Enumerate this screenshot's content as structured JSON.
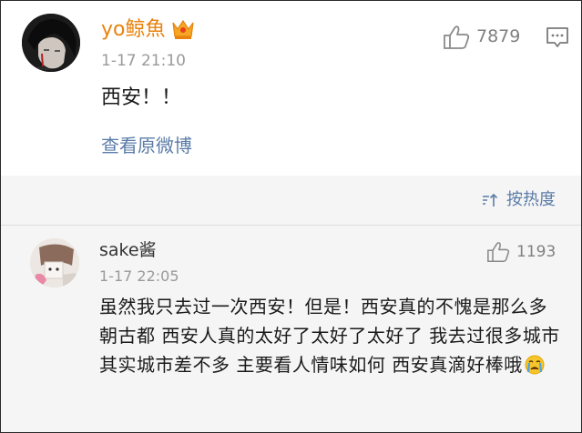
{
  "post": {
    "username": "yo鲸魚",
    "timestamp": "1-17 21:10",
    "likes": "7879",
    "text": "西安！！",
    "view_original": "查看原微博"
  },
  "sort": {
    "label": "按热度"
  },
  "comment": {
    "username": "sake酱",
    "timestamp": "1-17 22:05",
    "likes": "1193",
    "text": "虽然我只去过一次西安！但是！西安真的不愧是那么多朝古都  西安人真的太好了太好了太好了  我去过很多城市  其实城市差不多  主要看人情味如何  西安真滴好棒哦"
  },
  "icons": {
    "crown": "crown-icon",
    "like": "thumbs-up-icon",
    "comment": "comment-icon",
    "sort": "sort-icon",
    "emoji": "crying-face-emoji"
  },
  "colors": {
    "username_vip": "#e8830f",
    "link": "#5b7ca8",
    "muted": "#9a9a9a"
  }
}
